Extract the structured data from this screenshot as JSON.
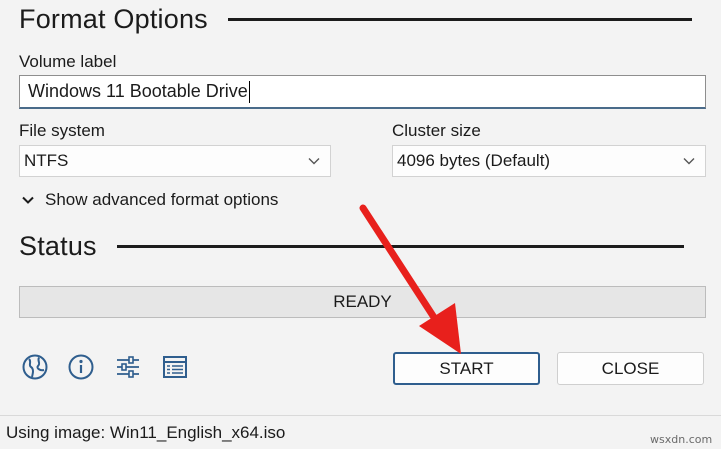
{
  "format_options": {
    "title": "Format Options",
    "volume_label_caption": "Volume label",
    "volume_label_value": "Windows 11 Bootable Drive",
    "file_system_caption": "File system",
    "file_system_value": "NTFS",
    "cluster_size_caption": "Cluster size",
    "cluster_size_value": "4096 bytes (Default)",
    "advanced_toggle": "Show advanced format options"
  },
  "status": {
    "title": "Status",
    "progress_text": "READY",
    "progress_fraction": 0
  },
  "toolbar": {
    "icons": [
      "globe-icon",
      "info-icon",
      "settings-sliders-icon",
      "log-icon"
    ],
    "start_label": "START",
    "close_label": "CLOSE"
  },
  "statusbar": {
    "text": "Using image: Win11_English_x64.iso"
  },
  "watermark": "wsxdn.com",
  "colors": {
    "background": "#f3f3f3",
    "icon_blue": "#2f5e8e",
    "annotation_red": "#e8201c"
  }
}
